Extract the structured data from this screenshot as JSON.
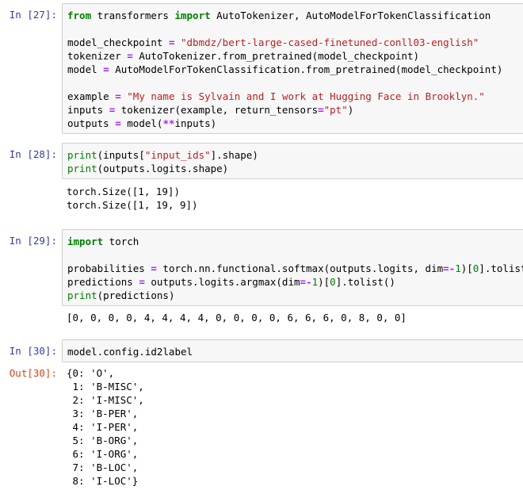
{
  "cells": [
    {
      "prompt": "In [27]:",
      "lines": [
        [
          {
            "t": "from",
            "c": "kw"
          },
          {
            "t": " transformers ",
            "c": "plain"
          },
          {
            "t": "import",
            "c": "kw"
          },
          {
            "t": " AutoTokenizer, AutoModelForTokenClassification",
            "c": "plain"
          }
        ],
        [],
        [
          {
            "t": "model_checkpoint ",
            "c": "plain"
          },
          {
            "t": "=",
            "c": "op"
          },
          {
            "t": " ",
            "c": "plain"
          },
          {
            "t": "\"dbmdz/bert-large-cased-finetuned-conll03-english\"",
            "c": "str"
          }
        ],
        [
          {
            "t": "tokenizer ",
            "c": "plain"
          },
          {
            "t": "=",
            "c": "op"
          },
          {
            "t": " AutoTokenizer.from_pretrained(model_checkpoint)",
            "c": "plain"
          }
        ],
        [
          {
            "t": "model ",
            "c": "plain"
          },
          {
            "t": "=",
            "c": "op"
          },
          {
            "t": " AutoModelForTokenClassification.from_pretrained(model_checkpoint)",
            "c": "plain"
          }
        ],
        [],
        [
          {
            "t": "example ",
            "c": "plain"
          },
          {
            "t": "=",
            "c": "op"
          },
          {
            "t": " ",
            "c": "plain"
          },
          {
            "t": "\"My name is Sylvain and I work at Hugging Face in Brooklyn.\"",
            "c": "str"
          }
        ],
        [
          {
            "t": "inputs ",
            "c": "plain"
          },
          {
            "t": "=",
            "c": "op"
          },
          {
            "t": " tokenizer(example, return_tensors",
            "c": "plain"
          },
          {
            "t": "=",
            "c": "op"
          },
          {
            "t": "\"pt\"",
            "c": "str"
          },
          {
            "t": ")",
            "c": "plain"
          }
        ],
        [
          {
            "t": "outputs ",
            "c": "plain"
          },
          {
            "t": "=",
            "c": "op"
          },
          {
            "t": " model(",
            "c": "plain"
          },
          {
            "t": "**",
            "c": "op"
          },
          {
            "t": "inputs)",
            "c": "plain"
          }
        ]
      ],
      "output_prompt": "",
      "output": []
    },
    {
      "prompt": "In [28]:",
      "lines": [
        [
          {
            "t": "print",
            "c": "bi"
          },
          {
            "t": "(inputs[",
            "c": "plain"
          },
          {
            "t": "\"input_ids\"",
            "c": "str"
          },
          {
            "t": "].shape)",
            "c": "plain"
          }
        ],
        [
          {
            "t": "print",
            "c": "bi"
          },
          {
            "t": "(outputs.logits.shape)",
            "c": "plain"
          }
        ]
      ],
      "output_prompt": "",
      "output": [
        "torch.Size([1, 19])",
        "torch.Size([1, 19, 9])"
      ]
    },
    {
      "prompt": "In [29]:",
      "lines": [
        [
          {
            "t": "import",
            "c": "kw"
          },
          {
            "t": " torch",
            "c": "plain"
          }
        ],
        [],
        [
          {
            "t": "probabilities ",
            "c": "plain"
          },
          {
            "t": "=",
            "c": "op"
          },
          {
            "t": " torch.nn.functional.softmax(outputs.logits, dim",
            "c": "plain"
          },
          {
            "t": "=-",
            "c": "op"
          },
          {
            "t": "1",
            "c": "num"
          },
          {
            "t": ")[",
            "c": "plain"
          },
          {
            "t": "0",
            "c": "num"
          },
          {
            "t": "].tolist()",
            "c": "plain"
          }
        ],
        [
          {
            "t": "predictions ",
            "c": "plain"
          },
          {
            "t": "=",
            "c": "op"
          },
          {
            "t": " outputs.logits.argmax(dim",
            "c": "plain"
          },
          {
            "t": "=-",
            "c": "op"
          },
          {
            "t": "1",
            "c": "num"
          },
          {
            "t": ")[",
            "c": "plain"
          },
          {
            "t": "0",
            "c": "num"
          },
          {
            "t": "].tolist()",
            "c": "plain"
          }
        ],
        [
          {
            "t": "print",
            "c": "bi"
          },
          {
            "t": "(predictions)",
            "c": "plain"
          }
        ]
      ],
      "output_prompt": "",
      "output": [
        "[0, 0, 0, 0, 4, 4, 4, 4, 0, 0, 0, 0, 6, 6, 6, 0, 8, 0, 0]"
      ]
    },
    {
      "prompt": "In [30]:",
      "lines": [
        [
          {
            "t": "model.config.id2label",
            "c": "plain"
          }
        ]
      ],
      "output_prompt": "Out[30]:",
      "output": [
        "{0: 'O',",
        " 1: 'B-MISC',",
        " 2: 'I-MISC',",
        " 3: 'B-PER',",
        " 4: 'I-PER',",
        " 5: 'B-ORG',",
        " 6: 'I-ORG',",
        " 7: 'B-LOC',",
        " 8: 'I-LOC'}"
      ]
    }
  ]
}
